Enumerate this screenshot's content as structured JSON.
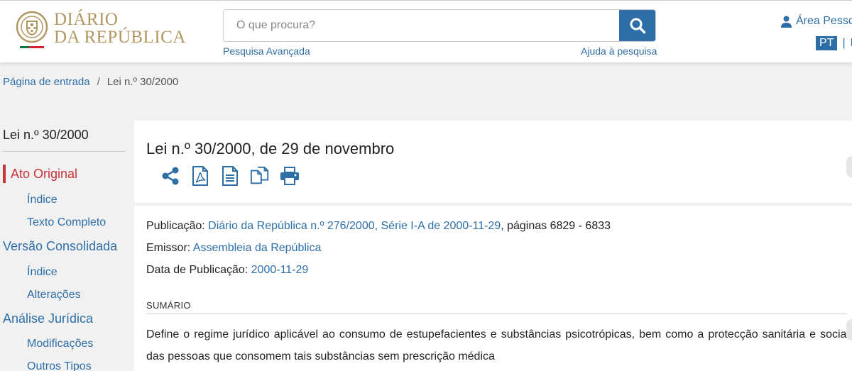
{
  "header": {
    "logo_line1": "DIÁRIO",
    "logo_line2": "DA REPÚBLICA",
    "search_placeholder": "O que procura?",
    "advanced_search": "Pesquisa Avançada",
    "search_help": "Ajuda à pesquisa",
    "user_area": "Área Pessoal",
    "lang_pt": "PT",
    "lang_sep": "|",
    "lang_en": "EN"
  },
  "breadcrumb": {
    "home": "Página de entrada",
    "sep": "/",
    "current": "Lei n.º 30/2000"
  },
  "sidebar": {
    "title": "Lei n.º 30/2000",
    "items": [
      {
        "label": "Ato Original"
      },
      {
        "label": "Índice"
      },
      {
        "label": "Texto Completo"
      },
      {
        "label": "Versão Consolidada"
      },
      {
        "label": "Índice"
      },
      {
        "label": "Alterações"
      },
      {
        "label": "Análise Jurídica"
      },
      {
        "label": "Modificações"
      },
      {
        "label": "Outros Tipos"
      }
    ]
  },
  "document": {
    "title": "Lei n.º 30/2000, de 29 de novembro",
    "actions": [
      "share-icon",
      "pdf-icon",
      "document-icon",
      "copy-icon",
      "print-icon"
    ],
    "publicacao_label": "Publicação:",
    "publicacao_link": "Diário da República n.º 276/2000, Série I-A de 2000-11-29",
    "publicacao_pages": ", páginas 6829 - 6833",
    "emissor_label": "Emissor:",
    "emissor_link": "Assembleia da República",
    "data_label": "Data de Publicação:",
    "data_link": "2000-11-29",
    "sumario_label": "SUMÁRIO",
    "sumario_text": "Define o regime jurídico aplicável ao consumo de estupefacientes e substâncias psicotrópicas, bem como a protecção sanitária e social das pessoas que consomem tais substâncias sem prescrição médica"
  },
  "colors": {
    "accent": "#2e6ea7",
    "active": "#c8323a",
    "logo_gold": "#b29762"
  }
}
